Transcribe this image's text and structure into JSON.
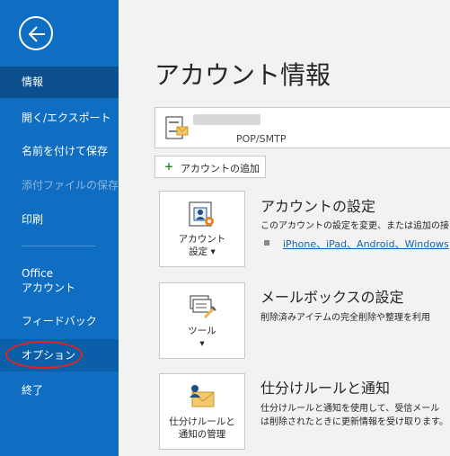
{
  "sidebar": {
    "items": [
      {
        "label": "情報"
      },
      {
        "label": "開く/エクスポート"
      },
      {
        "label": "名前を付けて保存"
      },
      {
        "label": "添付ファイルの保存"
      },
      {
        "label": "印刷"
      },
      {
        "label": "Office"
      },
      {
        "label": "アカウント"
      },
      {
        "label": "フィードバック"
      },
      {
        "label": "オプション"
      },
      {
        "label": "終了"
      }
    ]
  },
  "main": {
    "title": "アカウント情報",
    "account_type": "POP/SMTP",
    "add_account_label": "アカウントの追加",
    "sections": [
      {
        "tile_line1": "アカウント",
        "tile_line2": "設定 ▾",
        "title": "アカウントの設定",
        "text1": "このアカウントの設定を変更、または追加の接",
        "link": "iPhone、iPad、Android、Windows"
      },
      {
        "tile_line1": "ツール",
        "tile_line2": "▾",
        "title": "メールボックスの設定",
        "text1": "削除済みアイテムの完全削除や整理を利用"
      },
      {
        "tile_line1": "仕分けルールと",
        "tile_line2": "通知の管理",
        "title": "仕分けルールと通知",
        "text1": "仕分けルールと通知を使用して、受信メール",
        "text2": "は削除されたときに更新情報を受け取ります。"
      }
    ]
  },
  "colors": {
    "sidebar": "#0f6ec1",
    "active": "#0b4f8c",
    "highlight": "#e02424"
  }
}
